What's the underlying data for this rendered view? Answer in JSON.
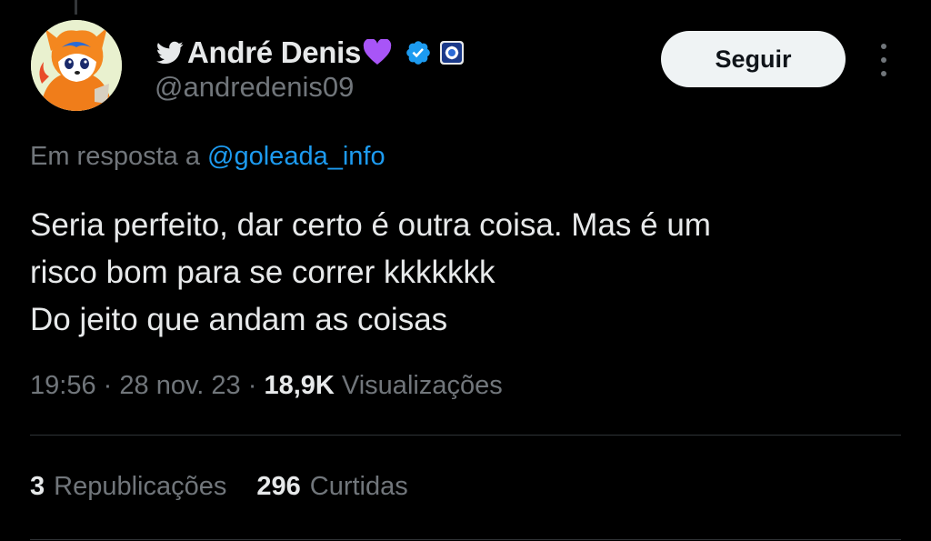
{
  "author": {
    "display_name": "André Denis",
    "handle": "@andredenis09",
    "icons": [
      "twitter-bird-icon",
      "purple-heart-icon",
      "verified-badge-icon",
      "affiliate-badge-icon"
    ]
  },
  "follow_button": {
    "label": "Seguir"
  },
  "reply_context": {
    "prefix": "Em resposta a",
    "mention": "@goleada_info"
  },
  "tweet": {
    "lines": [
      "Seria perfeito, dar certo é outra coisa. Mas é um",
      "risco bom para se correr kkkkkkk",
      "Do jeito que andam as coisas"
    ]
  },
  "meta": {
    "time": "19:56",
    "separator": "·",
    "date": "28 nov. 23",
    "views_count": "18,9K",
    "views_label": "Visualizações"
  },
  "stats": {
    "reposts_count": "3",
    "reposts_label": "Republicações",
    "likes_count": "296",
    "likes_label": "Curtidas"
  },
  "colors": {
    "background": "#000000",
    "text_primary": "#e7e9ea",
    "text_secondary": "#71767b",
    "link": "#1d9bf0",
    "verified": "#1d9bf0",
    "heart": "#a855f7",
    "follow_button_bg": "#eff3f4",
    "divider": "#2f3336"
  }
}
